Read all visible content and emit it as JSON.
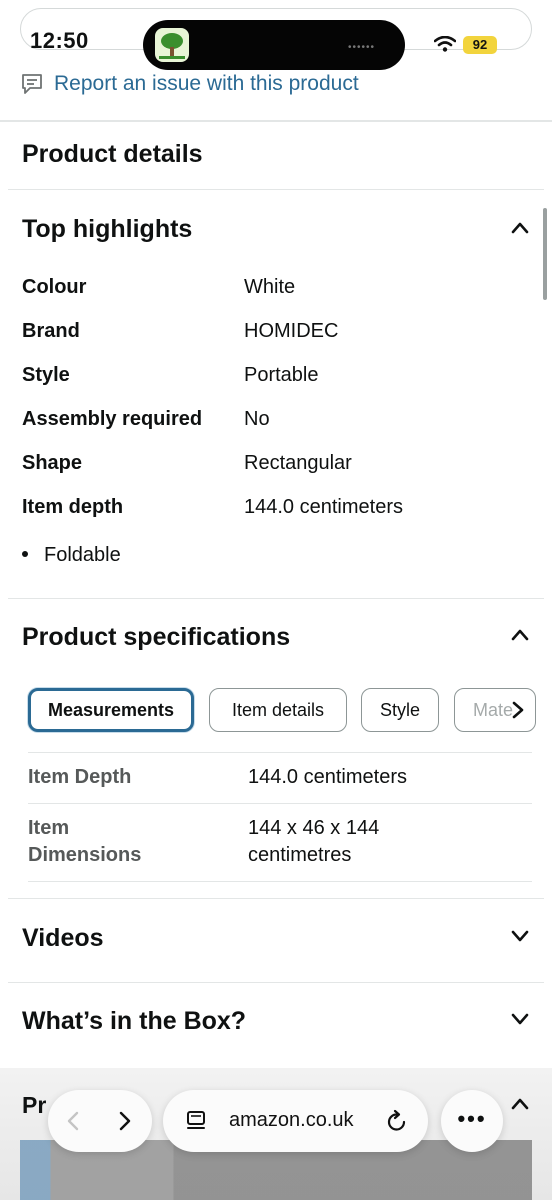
{
  "status_bar": {
    "time": "12:50",
    "battery": "92"
  },
  "report_link": "Report an issue with this product",
  "product_details_title": "Product details",
  "top_highlights": {
    "title": "Top highlights",
    "rows": [
      {
        "key": "Colour",
        "value": "White"
      },
      {
        "key": "Brand",
        "value": "HOMIDEC"
      },
      {
        "key": "Style",
        "value": "Portable"
      },
      {
        "key": "Assembly required",
        "value": "No"
      },
      {
        "key": "Shape",
        "value": "Rectangular"
      },
      {
        "key": "Item depth",
        "value": "144.0 centimeters"
      }
    ],
    "bullet": "Foldable"
  },
  "product_specifications": {
    "title": "Product specifications",
    "tabs": [
      "Measurements",
      "Item details",
      "Style",
      "Mate"
    ],
    "active_tab": "Measurements",
    "table": [
      {
        "key": "Item Depth",
        "value": "144.0 centimeters"
      },
      {
        "key_line1": "Item",
        "key_line2": "Dimensions",
        "value_line1": "144 x 46 x 144",
        "value_line2": "centimetres"
      }
    ]
  },
  "videos_title": "Videos",
  "whats_in_box_title": "What’s in the Box?",
  "obscured_heading": "Pr",
  "browser": {
    "url": "amazon.co.uk",
    "more_label": "•••"
  },
  "colors": {
    "link": "#2b6a94",
    "battery": "#f2d43d",
    "active_tab_border": "#2b6a94"
  }
}
